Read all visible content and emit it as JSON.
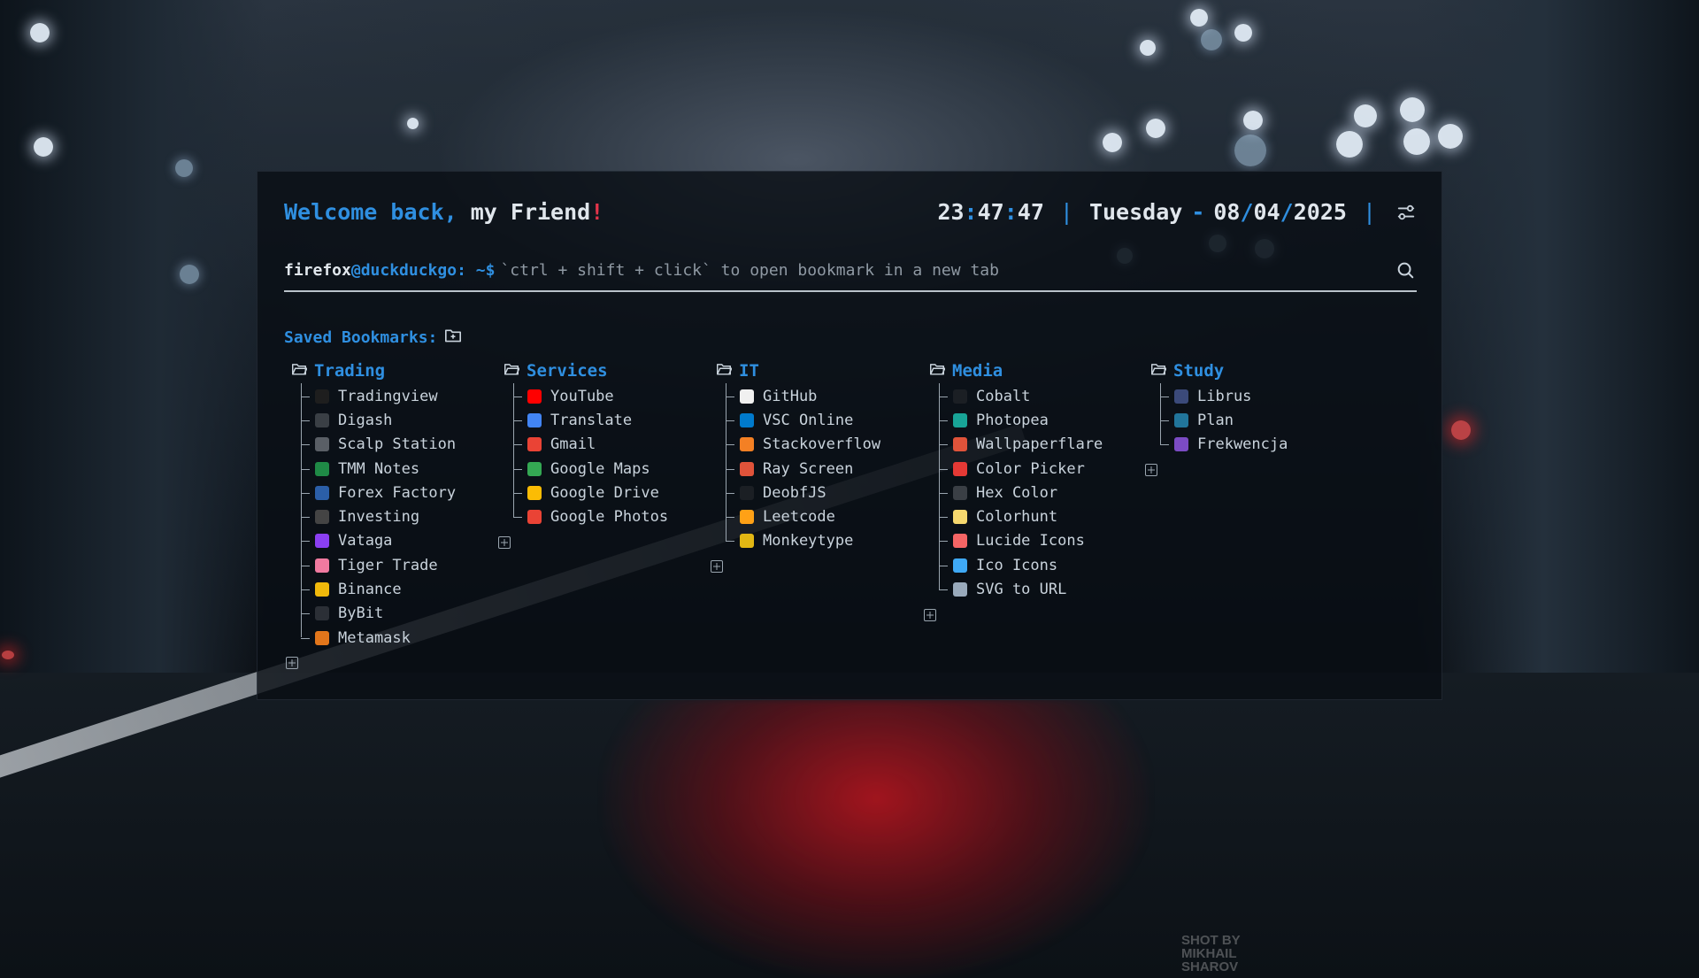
{
  "header": {
    "welcome_part1": "Welcome back,",
    "welcome_part2": "my Friend",
    "welcome_bang": "!",
    "hours": "23",
    "minutes": "47",
    "seconds": "47",
    "day": "Tuesday",
    "date_dd": "08",
    "date_mm": "04",
    "date_yyyy": "2025"
  },
  "prompt": {
    "user": "firefox",
    "at": "@",
    "host": "duckduckgo",
    "path": ": ~$",
    "placeholder": "`ctrl + shift + click` to open bookmark in a new tab"
  },
  "saved_label": "Saved Bookmarks:",
  "watermark": "SHOT BY MIKHAIL SHAROV",
  "groups": [
    {
      "title": "Trading",
      "items": [
        {
          "label": "Tradingview",
          "icon": "tradingview-icon",
          "color": "#1e1e1e"
        },
        {
          "label": "Digash",
          "icon": "digash-icon",
          "color": "#3a3f45"
        },
        {
          "label": "Scalp Station",
          "icon": "scalp-station-icon",
          "color": "#5a5f66"
        },
        {
          "label": "TMM Notes",
          "icon": "tmm-notes-icon",
          "color": "#1f8a46"
        },
        {
          "label": "Forex Factory",
          "icon": "forex-factory-icon",
          "color": "#2b5fa8"
        },
        {
          "label": "Investing",
          "icon": "investing-icon",
          "color": "#444444"
        },
        {
          "label": "Vataga",
          "icon": "vataga-icon",
          "color": "#8b3ff2"
        },
        {
          "label": "Tiger Trade",
          "icon": "tiger-trade-icon",
          "color": "#f07aa0"
        },
        {
          "label": "Binance",
          "icon": "binance-icon",
          "color": "#f0b90b"
        },
        {
          "label": "ByBit",
          "icon": "bybit-icon",
          "color": "#2b2f36"
        },
        {
          "label": "Metamask",
          "icon": "metamask-icon",
          "color": "#e2761b"
        }
      ]
    },
    {
      "title": "Services",
      "items": [
        {
          "label": "YouTube",
          "icon": "youtube-icon",
          "color": "#ff0000"
        },
        {
          "label": "Translate",
          "icon": "translate-icon",
          "color": "#4285f4"
        },
        {
          "label": "Gmail",
          "icon": "gmail-icon",
          "color": "#ea4335"
        },
        {
          "label": "Google Maps",
          "icon": "google-maps-icon",
          "color": "#34a853"
        },
        {
          "label": "Google Drive",
          "icon": "google-drive-icon",
          "color": "#fbbc04"
        },
        {
          "label": "Google Photos",
          "icon": "google-photos-icon",
          "color": "#ea4335"
        }
      ]
    },
    {
      "title": "IT",
      "items": [
        {
          "label": "GitHub",
          "icon": "github-icon",
          "color": "#f0f0f0"
        },
        {
          "label": "VSC Online",
          "icon": "vscode-icon",
          "color": "#007acc"
        },
        {
          "label": "Stackoverflow",
          "icon": "stackoverflow-icon",
          "color": "#f48024"
        },
        {
          "label": "Ray Screen",
          "icon": "ray-screen-icon",
          "color": "#e0533a"
        },
        {
          "label": "DeobfJS",
          "icon": "deobfjs-icon",
          "color": "#1b1f24"
        },
        {
          "label": "Leetcode",
          "icon": "leetcode-icon",
          "color": "#ffa116"
        },
        {
          "label": "Monkeytype",
          "icon": "monkeytype-icon",
          "color": "#e2b714"
        }
      ]
    },
    {
      "title": "Media",
      "items": [
        {
          "label": "Cobalt",
          "icon": "cobalt-icon",
          "color": "#1b1f24"
        },
        {
          "label": "Photopea",
          "icon": "photopea-icon",
          "color": "#18a497"
        },
        {
          "label": "Wallpaperflare",
          "icon": "wallpaperflare-icon",
          "color": "#e0533a"
        },
        {
          "label": "Color Picker",
          "icon": "color-picker-icon",
          "color": "#e53935"
        },
        {
          "label": "Hex Color",
          "icon": "hex-color-icon",
          "color": "#3a3f45"
        },
        {
          "label": "Colorhunt",
          "icon": "colorhunt-icon",
          "color": "#f5d76e"
        },
        {
          "label": "Lucide Icons",
          "icon": "lucide-icon",
          "color": "#f56565"
        },
        {
          "label": "Ico Icons",
          "icon": "ico-icons-icon",
          "color": "#3fa9f5"
        },
        {
          "label": "SVG to URL",
          "icon": "svg-to-url-icon",
          "color": "#9ab"
        }
      ]
    },
    {
      "title": "Study",
      "items": [
        {
          "label": "Librus",
          "icon": "librus-icon",
          "color": "#3b4a7a"
        },
        {
          "label": "Plan",
          "icon": "wordpress-icon",
          "color": "#21759b"
        },
        {
          "label": "Frekwencja",
          "icon": "frekwencja-icon",
          "color": "#7b4bc4"
        }
      ]
    }
  ]
}
